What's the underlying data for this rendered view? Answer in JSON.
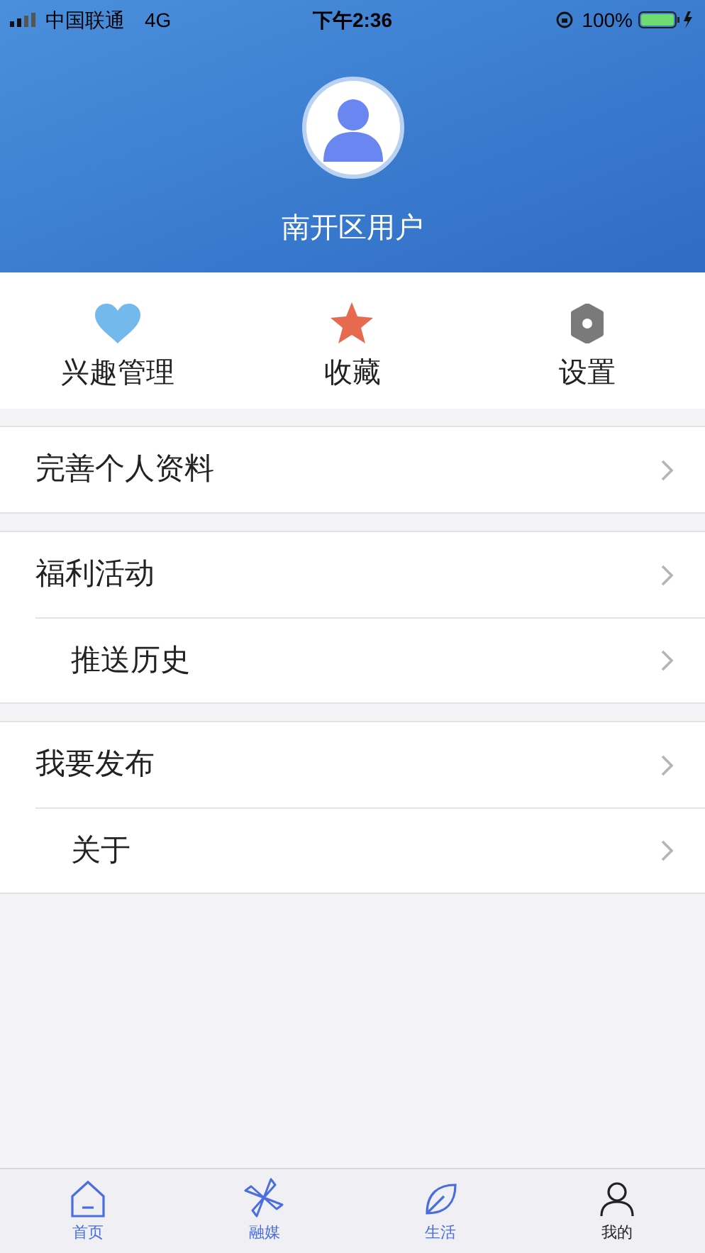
{
  "status_bar": {
    "carrier": "中国联通",
    "network": "4G",
    "time": "下午2:36",
    "battery_percent": "100%"
  },
  "profile": {
    "name": "南开区用户"
  },
  "quick_actions": [
    {
      "kind": "heart",
      "label": "兴趣管理"
    },
    {
      "kind": "star",
      "label": "收藏"
    },
    {
      "kind": "gear",
      "label": "设置"
    }
  ],
  "menu_groups": [
    {
      "items": [
        {
          "label": "完善个人资料"
        }
      ]
    },
    {
      "items": [
        {
          "label": "福利活动"
        },
        {
          "label": "推送历史"
        }
      ]
    },
    {
      "items": [
        {
          "label": "我要发布"
        },
        {
          "label": "关于"
        }
      ]
    }
  ],
  "tab_bar": [
    {
      "kind": "home",
      "label": "首页",
      "selected": false
    },
    {
      "kind": "pinwheel",
      "label": "融媒",
      "selected": false
    },
    {
      "kind": "life",
      "label": "生活",
      "selected": false
    },
    {
      "kind": "person",
      "label": "我的",
      "selected": true
    }
  ]
}
